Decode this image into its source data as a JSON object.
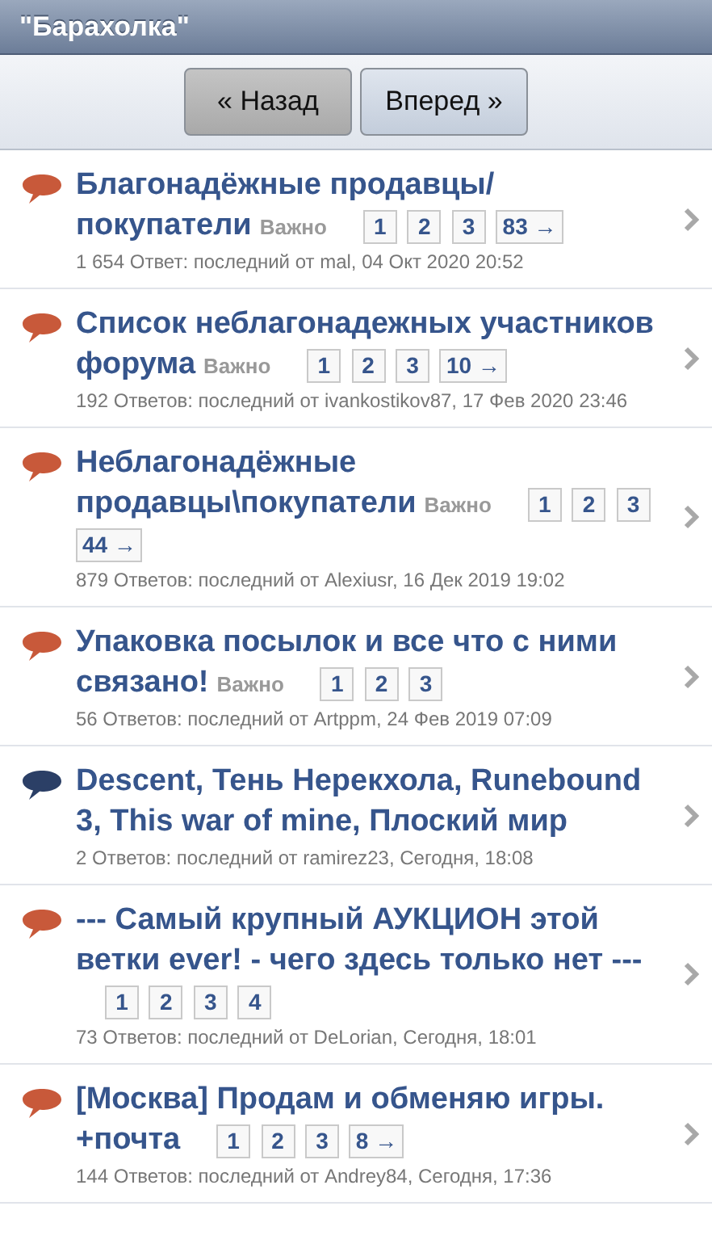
{
  "header": {
    "title": "\"Барахолка\""
  },
  "nav": [
    {
      "label": "« Назад",
      "disabled": true
    },
    {
      "label": "Вперед »",
      "disabled": false
    }
  ],
  "topics": [
    {
      "title_lines": [
        "Благонадёжные продавцы/",
        "покупатели"
      ],
      "sticky": "Важно",
      "color": "#c8593a",
      "pages": [
        "1",
        "2",
        "3",
        "83 →"
      ],
      "meta": "1 654 Ответ: последний от mal, 04 Окт 2020 20:52"
    },
    {
      "title_lines": [
        "Список неблагонадежных участников",
        "форума"
      ],
      "sticky": "Важно",
      "color": "#c8593a",
      "pages": [
        "1",
        "2",
        "3",
        "10 →"
      ],
      "meta": "192 Ответов: последний от ivankostikov87, 17 Фев 2020 23:46"
    },
    {
      "title_lines": [
        "Неблагонадёжные",
        "продавцы\\покупатели"
      ],
      "sticky": "Важно",
      "color": "#c8593a",
      "pages": [
        "1",
        "2",
        "3",
        "44 →"
      ],
      "meta": "879 Ответов: последний от Alexiusr, 16 Дек 2019 19:02"
    },
    {
      "title_lines": [
        "Упаковка посылок и все что с ними",
        "связано!"
      ],
      "sticky": "Важно",
      "color": "#c8593a",
      "pages": [
        "1",
        "2",
        "3"
      ],
      "meta": "56 Ответов: последний от Artppm, 24 Фев 2019 07:09"
    },
    {
      "title_lines": [
        "Descent, Тень Нерекхола, Runebound",
        "3, This war of mine, Плоский мир"
      ],
      "color": "#2b3f66",
      "meta": "2 Ответов: последний от ramirez23, Сегодня, 18:08"
    },
    {
      "title_lines": [
        "--- Самый крупный АУКЦИОН этой",
        "ветки ever! - чего здесь только нет ---"
      ],
      "color": "#c8593a",
      "pages": [
        "1",
        "2",
        "3",
        "4"
      ],
      "meta": "73 Ответов: последний от DeLorian, Сегодня, 18:01"
    },
    {
      "title_lines": [
        "[Москва] Продам и обменяю игры.",
        "+почта"
      ],
      "color": "#c8593a",
      "pages": [
        "1",
        "2",
        "3",
        "8 →"
      ],
      "meta": "144 Ответов: последний от Andrey84, Сегодня, 17:36"
    }
  ]
}
